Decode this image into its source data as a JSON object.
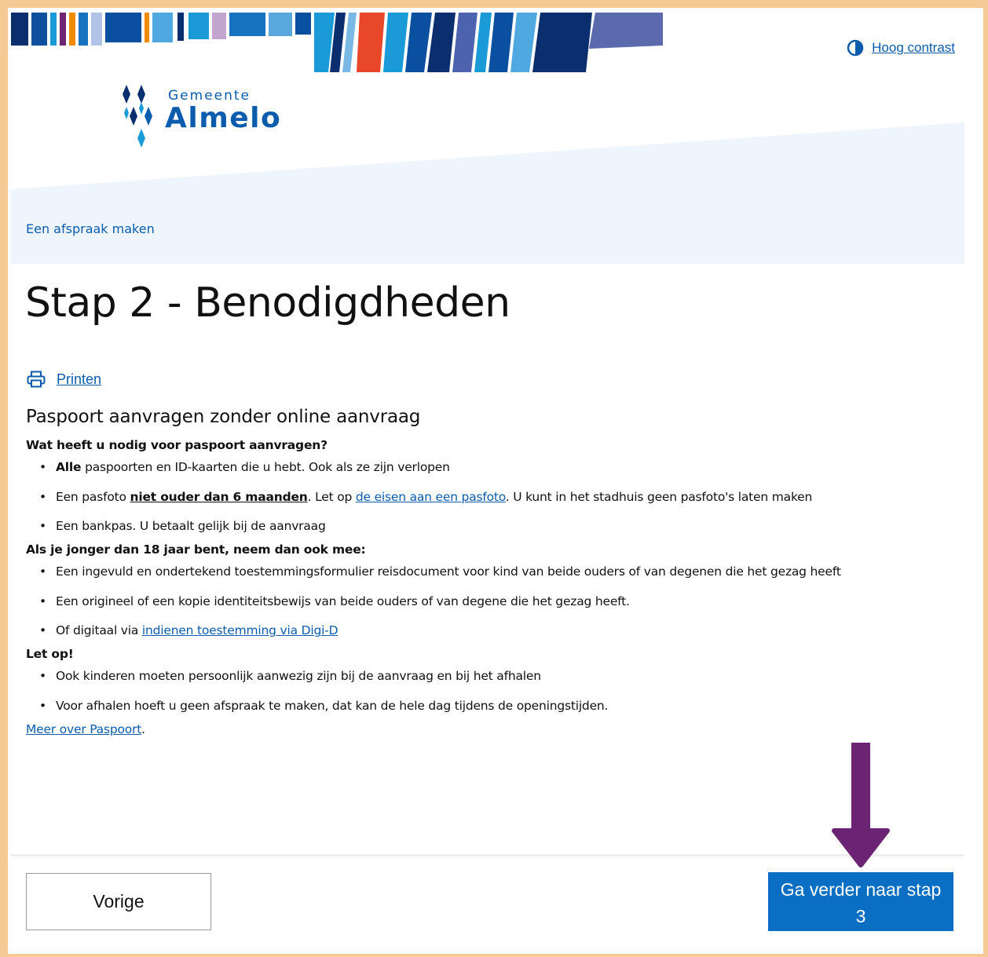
{
  "header": {
    "contrast_label": "Hoog contrast",
    "logo_small": "Gemeente",
    "logo_big": "Almelo",
    "breadcrumb": "Een afspraak maken"
  },
  "page": {
    "title": "Stap 2 - Benodigdheden",
    "print_label": "Printen"
  },
  "content": {
    "heading": "Paspoort aanvragen zonder online aanvraag",
    "section1_title": "Wat heeft u nodig voor paspoort aanvragen?",
    "s1_item1_bold": "Alle",
    "s1_item1_rest": " paspoorten en ID-kaarten die u hebt. Ook als ze zijn verlopen",
    "s1_item2_pre": "Een pasfoto ",
    "s1_item2_bold": "niet ouder dan 6 maanden",
    "s1_item2_mid": ". Let op ",
    "s1_item2_link": "de eisen aan een pasfoto",
    "s1_item2_post": ". U kunt in het stadhuis geen pasfoto's laten maken",
    "s1_item3": "Een bankpas. U betaalt gelijk bij de aanvraag",
    "section2_title": "Als je jonger dan 18 jaar bent, neem dan ook mee:",
    "s2_item1": "Een ingevuld en ondertekend toestemmingsformulier reisdocument voor kind van beide ouders of van degenen die het gezag heeft",
    "s2_item2": "Een origineel of een kopie identiteitsbewijs van beide ouders of van degene die het gezag heeft.",
    "s2_item3_pre": "Of digitaal via ",
    "s2_item3_link": "indienen toestemming via Digi-D",
    "section3_title": "Let op!",
    "s3_item1": "Ook kinderen moeten persoonlijk aanwezig zijn bij de aanvraag en bij het afhalen",
    "s3_item2": "Voor afhalen hoeft u geen afspraak te maken, dat kan de hele dag tijdens de openingstijden.",
    "more_link": "Meer over Paspoort",
    "more_dot": "."
  },
  "footer": {
    "prev_label": "Vorige",
    "next_label_line1": "Ga verder naar stap",
    "next_label_line2": "3"
  },
  "colors": {
    "frame": "#f6c995",
    "link": "#0b5cad",
    "primary_button": "#0a6fc2",
    "annotation_arrow": "#6b2473"
  },
  "icons": [
    "contrast-icon",
    "print-icon",
    "logo-diamonds-icon"
  ]
}
